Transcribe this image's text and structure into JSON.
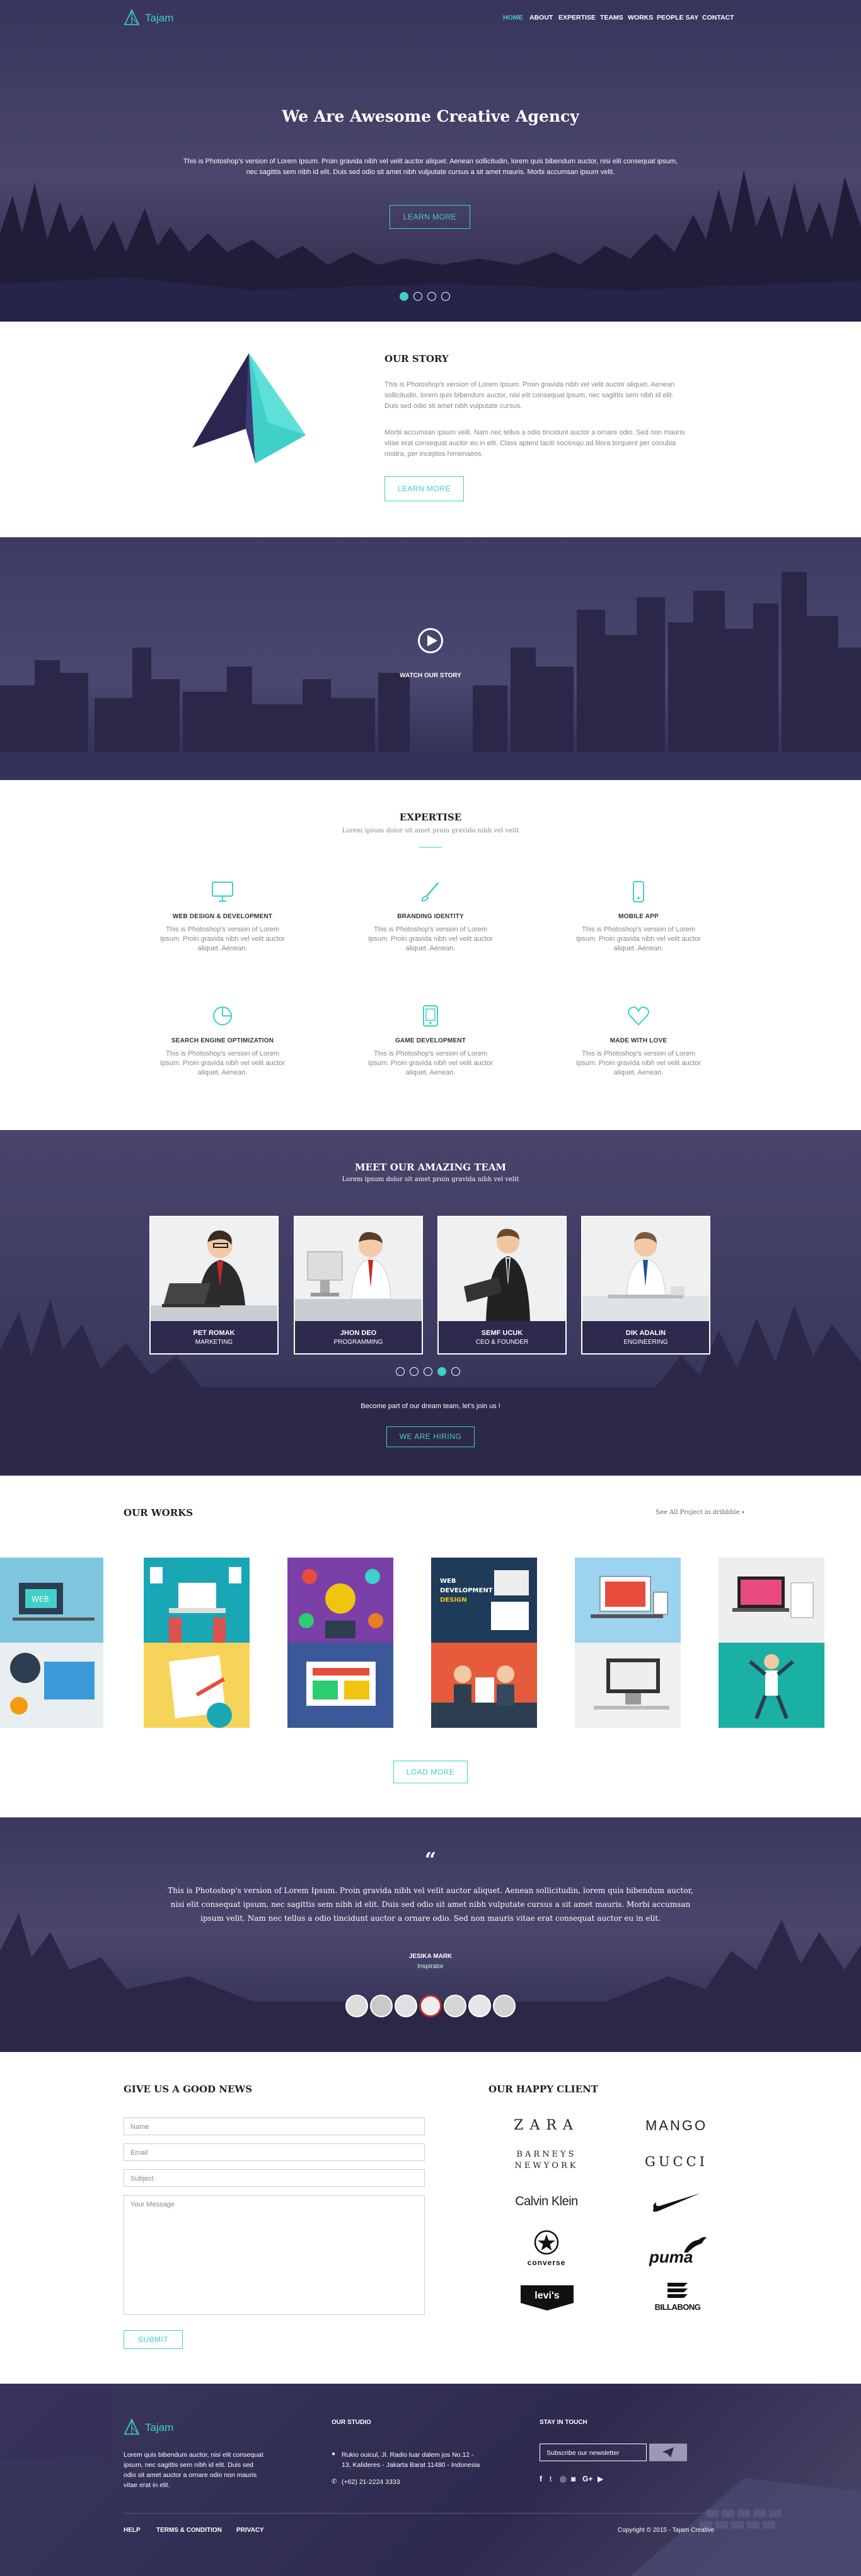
{
  "brand": {
    "name": "Tajam"
  },
  "nav": {
    "items": [
      "HOME",
      "ABOUT",
      "EXPERTISE",
      "TEAMS",
      "WORKS",
      "PEOPLE SAY",
      "CONTACT"
    ]
  },
  "hero": {
    "title": "We Are Awesome Creative Agency",
    "text": "This is Photoshop's version of Lorem Ipsum. Proin gravida nibh vel velit auctor aliquet. Aenean sollicitudin, lorem quis bibendum auctor, nisi elit consequat ipsum, nec sagittis sem nibh id elit. Duis sed odio sit amet nibh vulputate cursus a sit amet mauris. Morbi accumsan ipsum velit.",
    "button": "LEARN MORE",
    "slides": 4,
    "active_slide": 0
  },
  "story": {
    "title": "OUR STORY",
    "p1": "This is Photoshop's version of Lorem Ipsum. Proin gravida nibh vel velit auctor aliquet. Aenean sollicitudin, lorem quis bibendum auctor, nisi elit consequat ipsum, nec sagittis sem nibh id elit. Duis sed odio sit amet nibh vulputate cursus.",
    "p2": "Morbi accumsan ipsum velit. Nam nec tellus a odio tincidunt auctor a ornare odio. Sed non mauris vitae erat consequat auctor eu in elit. Class aptent taciti sociosqu ad litora torquent per conubia nostra, per inceptos himenaeos.",
    "button": "LEARN MORE"
  },
  "video": {
    "label": "WATCH OUR STORY"
  },
  "expertise": {
    "title": "EXPERTISE",
    "subtitle": "Lorem ipsum dolor sit amet proin gravida nibh vel velit",
    "items": [
      {
        "icon": "monitor-icon",
        "title": "WEB DESIGN & DEVELOPMENT",
        "text": "This is Photoshop's version of Lorem Ipsum. Proin gravida nibh vel velit auctor aliquet. Aenean."
      },
      {
        "icon": "brush-icon",
        "title": "BRANDING IDENTITY",
        "text": "This is Photoshop's version of Lorem Ipsum. Proin gravida nibh vel velit auctor aliquet. Aenean."
      },
      {
        "icon": "mobile-icon",
        "title": "MOBILE APP",
        "text": "This is Photoshop's version of Lorem Ipsum. Proin gravida nibh vel velit auctor aliquet. Aenean."
      },
      {
        "icon": "pie-chart-icon",
        "title": "SEARCH ENGINE OPTIMIZATION",
        "text": "This is Photoshop's version of Lorem Ipsum. Proin gravida nibh vel velit auctor aliquet. Aenean."
      },
      {
        "icon": "tablet-icon",
        "title": "GAME DEVELOPMENT",
        "text": "This is Photoshop's version of Lorem Ipsum. Proin gravida nibh vel velit auctor aliquet. Aenean."
      },
      {
        "icon": "heart-icon",
        "title": "MADE WITH LOVE",
        "text": "This is Photoshop's version of Lorem Ipsum. Proin gravida nibh vel velit auctor aliquet. Aenean."
      }
    ]
  },
  "team": {
    "title": "MEET OUR AMAZING TEAM",
    "subtitle": "Lorem ipsum dolor sit amet proin gravida nibh vel velit",
    "members": [
      {
        "name": "PET ROMAK",
        "role": "MARKETING"
      },
      {
        "name": "JHON DEO",
        "role": "PROGRAMMING"
      },
      {
        "name": "SEMF UCUK",
        "role": "CEO & FOUNDER"
      },
      {
        "name": "DIK ADALIN",
        "role": "ENGINEERING"
      }
    ],
    "slides": 5,
    "active_slide": 3,
    "cta_text": "Become part of our dream team, let's join us !",
    "button": "WE ARE HIRING"
  },
  "works": {
    "title": "OUR WORKS",
    "see_all": "See All Project in dribbble",
    "button": "LOAD MORE"
  },
  "testimonial": {
    "quote": "This is Photoshop's version of Lorem Ipsum. Proin gravida nibh vel velit auctor aliquet. Aenean sollicitudin, lorem quis bibendum auctor, nisi elit consequat ipsum, nec sagittis sem nibh id elit. Duis sed odio sit amet nibh vulputate cursus a sit amet mauris. Morbi accumsan ipsum velit. Nam nec tellus a odio tincidunt auctor a ornare odio. Sed non mauris vitae erat consequat auctor eu in elit.",
    "name": "JESIKA MARK",
    "role": "Inspirator",
    "avatars": 7,
    "active_avatar": 3
  },
  "contact": {
    "title": "GIVE US A GOOD NEWS",
    "name_ph": "Name",
    "email_ph": "Email",
    "subject_ph": "Subject",
    "message_ph": "Your Message",
    "button": "SUBMIT"
  },
  "clients": {
    "title": "OUR HAPPY CLIENT",
    "logos": [
      "ZARA",
      "MANGO",
      "BARNEYS NEWYORK",
      "GUCCI",
      "Calvin Klein",
      "nike",
      "converse",
      "puma",
      "levi's",
      "BILLABONG"
    ]
  },
  "footer": {
    "about": "Lorem quis bibendum auctor, nisi elit consequat ipsum, nec sagittis sem nibh id elit. Duis sed odio sit amet auctor a ornare odio non mauris vitae erat in elit.",
    "studio_title": "OUR STUDIO",
    "address": "Rukio ouicul, Jl. Radio luar dalem jos No.12 - 13, Kalideres - Jakarta Barat 11480 - Indonesia",
    "phone": "(+62) 21-2224 3333",
    "touch_title": "STAY IN TOUCH",
    "newsletter_ph": "Subscribe our newsletter",
    "links": [
      "HELP",
      "TERMS & CONDITION",
      "PRIVACY"
    ],
    "copyright": "Copyright © 2015 - Tajam Creative"
  },
  "colors": {
    "accent": "#3fd0c9",
    "dark": "#2d2a4e"
  }
}
